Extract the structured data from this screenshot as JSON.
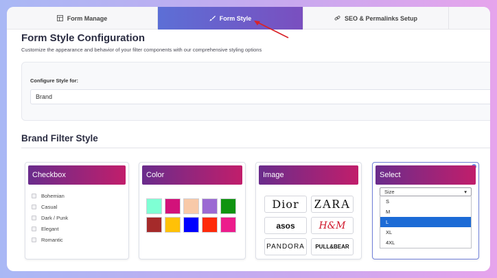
{
  "tabs": [
    {
      "label": "Form Manage",
      "icon": "table-icon",
      "active": false
    },
    {
      "label": "Form Style",
      "icon": "brush-icon",
      "active": true
    },
    {
      "label": "SEO & Permalinks Setup",
      "icon": "link-icon",
      "active": false
    }
  ],
  "header": {
    "title": "Form Style Configuration",
    "subtitle": "Customize the appearance and behavior of your filter components with our comprehensive styling options"
  },
  "config": {
    "label": "Configure Style for:",
    "value": "Brand"
  },
  "section_title": "Brand Filter Style",
  "cards": {
    "checkbox": {
      "title": "Checkbox",
      "items": [
        "Bohemian",
        "Casual",
        "Dark / Punk",
        "Elegant",
        "Romantic"
      ]
    },
    "color": {
      "title": "Color",
      "swatches": [
        "#7fffd4",
        "#d2127a",
        "#f8c9a8",
        "#9b6ad3",
        "#109410",
        "#a52a2a",
        "#ffc107",
        "#0000ff",
        "#ff2a0a",
        "#ec1c8c"
      ]
    },
    "image": {
      "title": "Image",
      "logos": [
        "Dior",
        "ZARA",
        "asos",
        "H&M",
        "PANDORA",
        "PULL&BEAR"
      ]
    },
    "select": {
      "title": "Select",
      "placeholder": "Size",
      "caret": "▾",
      "options": [
        "S",
        "M",
        "L",
        "XL",
        "4XL"
      ],
      "selected": "L"
    }
  }
}
